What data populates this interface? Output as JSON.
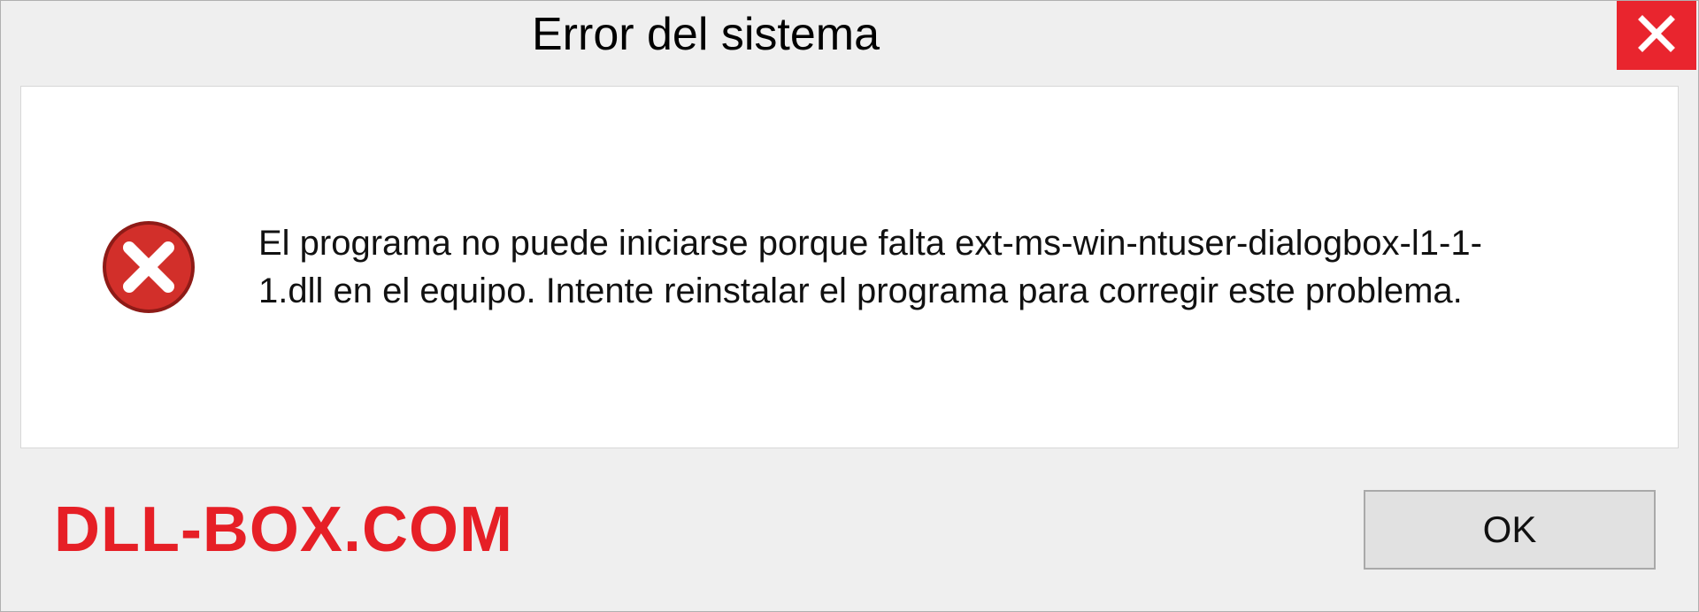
{
  "dialog": {
    "title": "Error del sistema",
    "message": "El programa no puede iniciarse porque falta ext-ms-win-ntuser-dialogbox-l1-1-1.dll en el equipo. Intente reinstalar el programa para corregir este problema.",
    "ok_label": "OK"
  },
  "watermark": "DLL-BOX.COM",
  "colors": {
    "close_bg": "#e9252e",
    "error_icon": "#d22f2a",
    "watermark": "#e61f26"
  }
}
